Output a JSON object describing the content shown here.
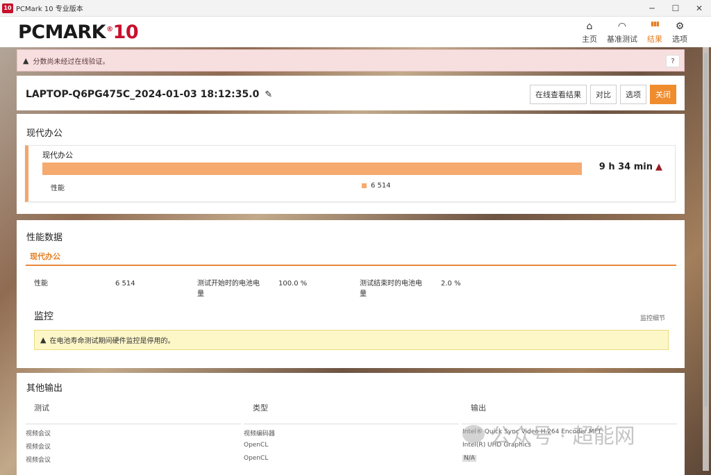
{
  "window": {
    "title": "PCMark 10 专业版本",
    "icon_text": "10",
    "minimize_glyph": "─",
    "maximize_glyph": "☐",
    "close_glyph": "✕"
  },
  "header": {
    "logo_text": "PCMARK",
    "logo_reg": "®",
    "logo_number": "10",
    "nav": [
      {
        "label": "主页",
        "icon": "home-icon",
        "glyph": "⌂"
      },
      {
        "label": "基准测试",
        "icon": "gauge-icon",
        "glyph": "◠"
      },
      {
        "label": "结果",
        "icon": "bar-chart-icon",
        "glyph": "▮▮▮"
      },
      {
        "label": "选项",
        "icon": "gear-icon",
        "glyph": "⚙"
      }
    ],
    "active_nav": "结果",
    "accent_color": "#e47f24"
  },
  "banner": {
    "text": "分数尚未经过在线验证。",
    "help": "?"
  },
  "run": {
    "title": "LAPTOP-Q6PG475C_2024-01-03 18:12:35.0",
    "edit_icon": "✎",
    "buttons": {
      "view_online": "在线查看结果",
      "compare": "对比",
      "options": "选项",
      "close": "关闭"
    }
  },
  "modern_office": {
    "section_title": "现代办公",
    "benchmark_name": "现代办公",
    "time": "9 h 34 min",
    "perf_label": "性能",
    "perf_value": "6 514",
    "bar_color": "#f5aa70"
  },
  "perf_data": {
    "section_title": "性能数据",
    "tab": "现代办公",
    "items": [
      {
        "label": "性能",
        "value": "6 514"
      },
      {
        "label": "测试开始时的电池电量",
        "value": "100.0 %"
      },
      {
        "label": "测试结束时的电池电量",
        "value": "2.0 %"
      }
    ],
    "monitor_title": "监控",
    "monitor_link": "监控细节",
    "monitor_notice": "在电池寿命测试期间硬件监控是停用的。"
  },
  "other_output": {
    "section_title": "其他输出",
    "columns": [
      "测试",
      "类型",
      "输出"
    ],
    "rows": [
      [
        "视频会议",
        "视频编码器",
        "Intel® Quick Sync Video H.264 Encoder MFT"
      ],
      [
        "视频会议",
        "OpenCL",
        "Intel(R) UHD Graphics"
      ],
      [
        "视频会议",
        "OpenCL",
        "N/A"
      ]
    ]
  },
  "watermark": {
    "text": "公众号 · 超能网"
  }
}
